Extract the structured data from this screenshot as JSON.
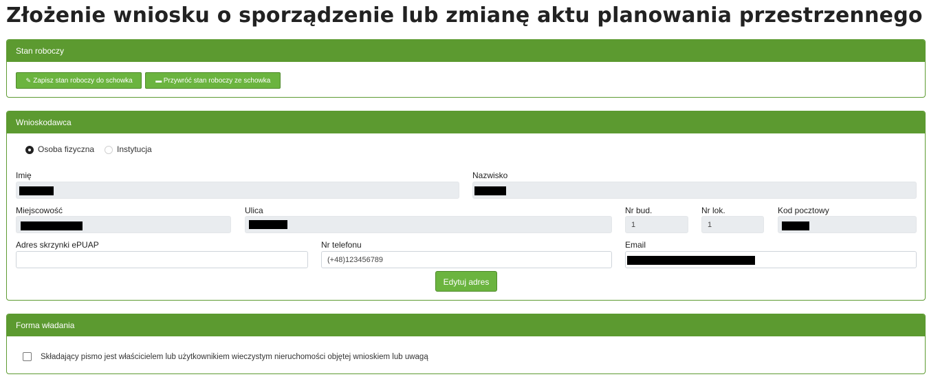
{
  "page": {
    "title": "Złożenie wniosku o sporządzenie lub zmianę aktu planowania przestrzennego"
  },
  "draft": {
    "header": "Stan roboczy",
    "save_label": "Zapisz stan roboczy do schowka",
    "restore_label": "Przywróć stan roboczy ze schowka"
  },
  "applicant": {
    "header": "Wnioskodawca",
    "radio_person": "Osoba fizyczna",
    "radio_institution": "Instytucja",
    "selected_type": "Osoba fizyczna",
    "first_name_label": "Imię",
    "last_name_label": "Nazwisko",
    "city_label": "Miejscowość",
    "street_label": "Ulica",
    "building_label": "Nr bud.",
    "building_value": "1",
    "apartment_label": "Nr lok.",
    "apartment_value": "1",
    "postal_label": "Kod pocztowy",
    "epuap_label": "Adres skrzynki ePUAP",
    "epuap_value": "",
    "phone_label": "Nr telefonu",
    "phone_value": "(+48)123456789",
    "email_label": "Email",
    "edit_address_label": "Edytuj adres"
  },
  "ownership": {
    "header": "Forma władania",
    "checkbox_label": "Składający pismo jest właścicielem lub użytkownikiem wieczystym nieruchomości objętej wnioskiem lub uwagą",
    "checked": false
  },
  "icons": {
    "save": "pencil-icon",
    "restore": "inbox-icon"
  },
  "colors": {
    "header_green": "#5c9a30",
    "button_green": "#6bb43f"
  }
}
